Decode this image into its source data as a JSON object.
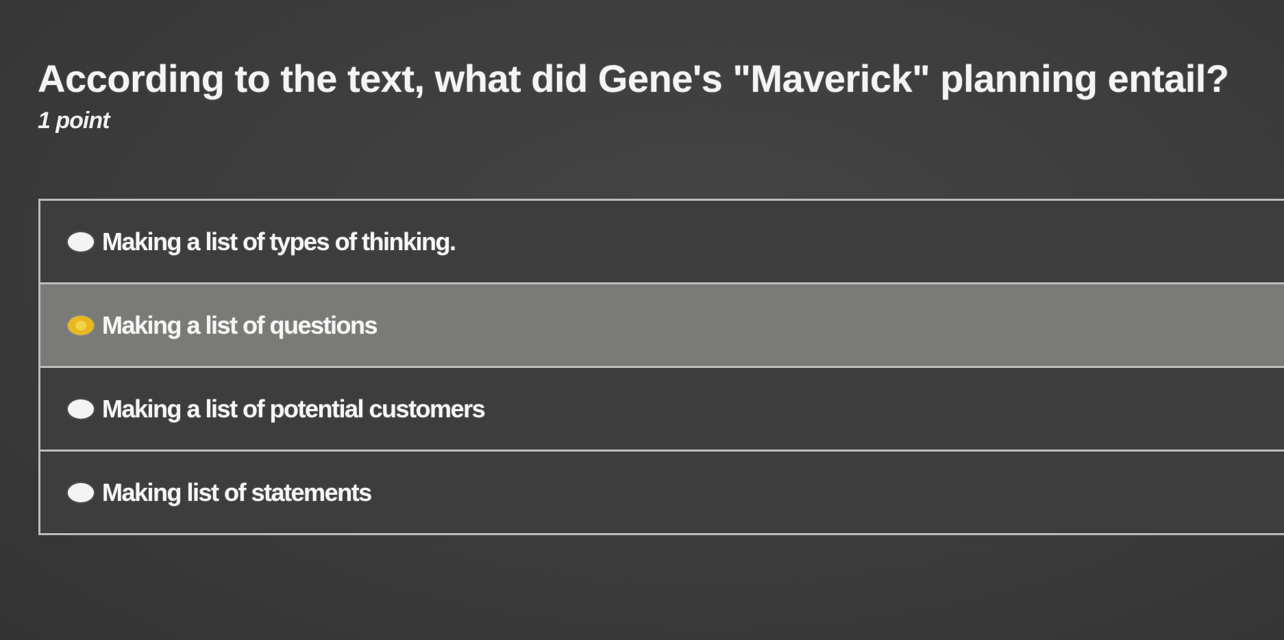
{
  "question": {
    "title": "According to the text, what did Gene's \"Maverick\" planning entail?",
    "points": "1 point"
  },
  "options": [
    {
      "label": "Making a list of types of thinking.",
      "selected": false
    },
    {
      "label": "Making a list of questions",
      "selected": true
    },
    {
      "label": "Making a list of potential customers",
      "selected": false
    },
    {
      "label": "Making list of statements",
      "selected": false
    }
  ],
  "colors": {
    "background": "#3c3c3c",
    "selected_row": "#7a7a76",
    "radio_checked": "#e8b820",
    "radio_unchecked": "#f4f4f4",
    "border": "#bdbdbd"
  }
}
